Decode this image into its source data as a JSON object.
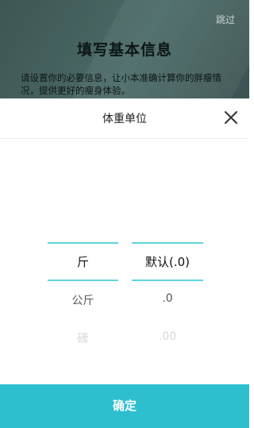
{
  "background_page": {
    "skip_label": "跳过",
    "title": "填写基本信息",
    "description": "请设置你的必要信息，让小本准确计算你的胖瘦情况，提供更好的瘦身体验。"
  },
  "sheet": {
    "title": "体重单位",
    "close_icon": "close-icon",
    "unit_column": {
      "options": [
        "斤",
        "公斤",
        "磅"
      ],
      "selected": "斤"
    },
    "precision_column": {
      "options": [
        "默认(.0)",
        ".0",
        ".00"
      ],
      "selected": "默认(.0)"
    },
    "confirm_label": "确定"
  },
  "colors": {
    "accent": "#2ebfcf",
    "selection_line": "#5fd4e1",
    "overlay": "#3b4f4d"
  }
}
